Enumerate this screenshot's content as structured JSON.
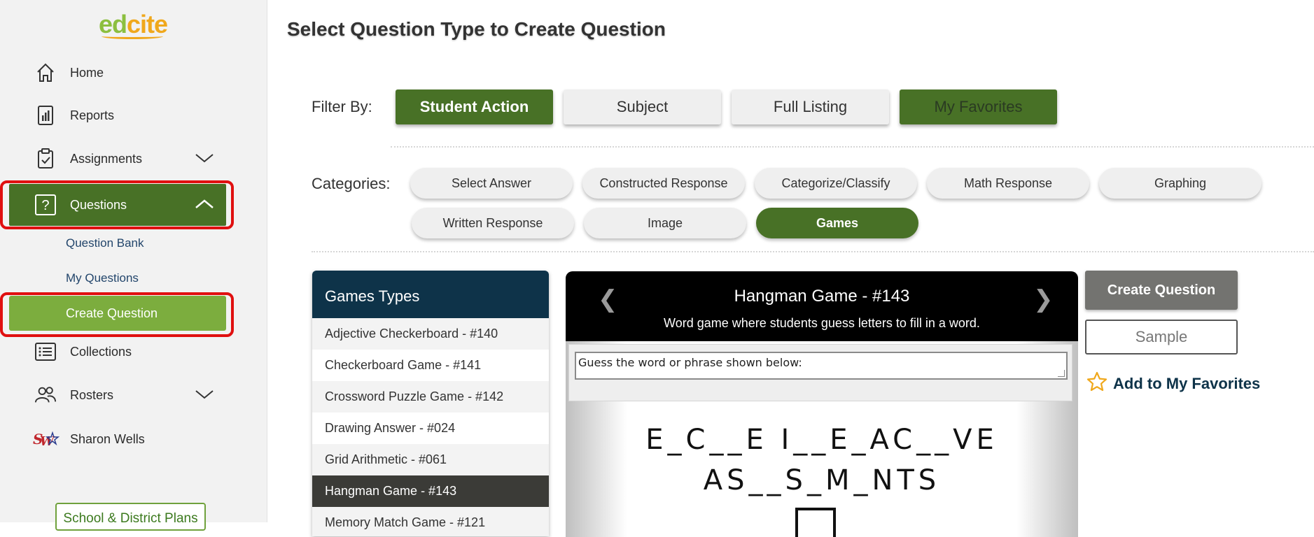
{
  "brand": {
    "logo_part1": "ed",
    "logo_part2": "cite"
  },
  "sidebar": {
    "items": [
      {
        "label": "Home",
        "icon": "home-icon"
      },
      {
        "label": "Reports",
        "icon": "reports-icon"
      },
      {
        "label": "Assignments",
        "icon": "clipboard-icon"
      },
      {
        "label": "Questions",
        "icon": "question-icon"
      },
      {
        "label": "Collections",
        "icon": "list-icon"
      },
      {
        "label": "Rosters",
        "icon": "users-icon"
      },
      {
        "label": "Sharon Wells",
        "icon": "sw-logo-icon"
      }
    ],
    "sub_items": [
      "Question Bank",
      "My Questions",
      "Create Question"
    ],
    "plans_label": "School & District Plans"
  },
  "main": {
    "title": "Select Question Type to Create Question",
    "filter_label": "Filter By:",
    "filters": [
      "Student Action",
      "Subject",
      "Full Listing",
      "My Favorites"
    ],
    "categories_label": "Categories:",
    "categories": [
      "Select Answer",
      "Constructed Response",
      "Categorize/Classify",
      "Math Response",
      "Graphing",
      "Written Response",
      "Image",
      "Games"
    ],
    "selected_category": "Games"
  },
  "games": {
    "header": "Games Types",
    "items": [
      "Adjective Checkerboard - #140",
      "Checkerboard Game - #141",
      "Crossword Puzzle Game - #142",
      "Drawing Answer - #024",
      "Grid Arithmetic - #061",
      "Hangman Game - #143",
      "Memory Match Game - #121"
    ],
    "selected": "Hangman Game - #143"
  },
  "preview": {
    "title": "Hangman Game - #143",
    "description": "Word game where students guess letters to fill in a word.",
    "prompt": "Guess the word or phrase shown below:",
    "line1": "E_C__E I__E_AC__VE",
    "line2": "AS__S_M_NTS",
    "prev_arrow": "❮",
    "next_arrow": "❯"
  },
  "actions": {
    "create_label": "Create Question",
    "sample_label": "Sample",
    "favorite_label": "Add to My Favorites"
  },
  "colors": {
    "green_dark": "#487126",
    "green_light": "#7cad3e",
    "navy": "#0e3349",
    "highlight_red": "#e01010"
  }
}
